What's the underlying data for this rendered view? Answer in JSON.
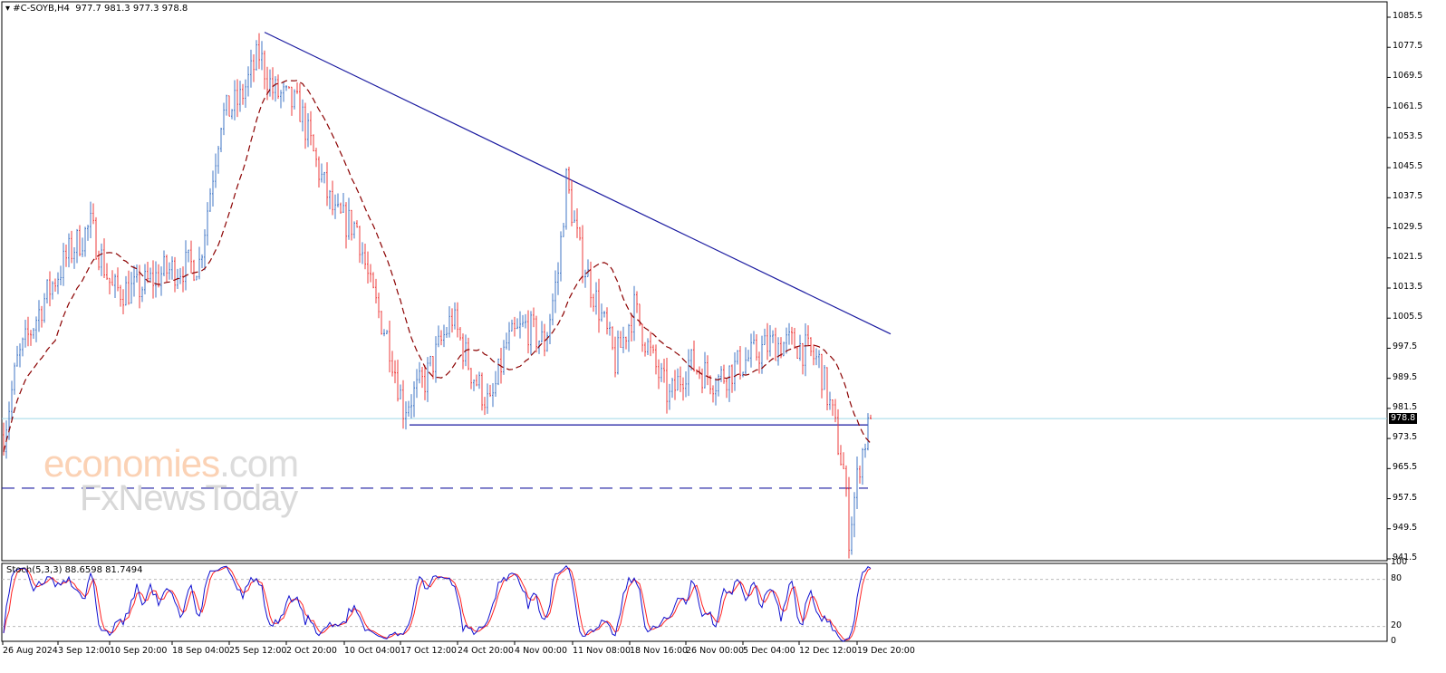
{
  "header": {
    "symbol": "#C-SOYB,H4",
    "ohlc": "977.7 981.3 977.3 978.8"
  },
  "stoch": {
    "label": "Stoch(5,3,3) 88.6598 81.7494",
    "levels": [
      "100",
      "80",
      "20",
      "0"
    ]
  },
  "watermark": {
    "brand1": "economies",
    "brand1_suffix": ".com",
    "brand2": "FxNewsToday"
  },
  "colors": {
    "up": "#3f74c4",
    "down": "#ee3b3b",
    "ma": "#8b0000",
    "trend": "#1a1aa0",
    "price_line": "#9fd8e8",
    "stoch_k": "#1010d0",
    "stoch_d": "#ff2020"
  },
  "chart_data": {
    "type": "ohlc",
    "title": "#C-SOYB,H4",
    "ylim": [
      941.5,
      1085.5
    ],
    "y_ticks": [
      "1085.5",
      "1077.5",
      "1069.5",
      "1061.5",
      "1053.5",
      "1045.5",
      "1037.5",
      "1029.5",
      "1021.5",
      "1013.5",
      "1005.5",
      "997.5",
      "989.5",
      "981.5",
      "973.5",
      "965.5",
      "957.5",
      "949.5",
      "941.5"
    ],
    "current_price": "978.8",
    "x_ticks": [
      "26 Aug 2024",
      "3 Sep 12:00",
      "10 Sep 20:00",
      "18 Sep 04:00",
      "25 Sep 12:00",
      "2 Oct 20:00",
      "10 Oct 04:00",
      "17 Oct 12:00",
      "24 Oct 20:00",
      "4 Nov 00:00",
      "11 Nov 08:00",
      "18 Nov 16:00",
      "26 Nov 00:00",
      "5 Dec 04:00",
      "12 Dec 12:00",
      "19 Dec 20:00"
    ],
    "bar_count": 320,
    "close_path": [
      [
        0,
        974.5
      ],
      [
        5,
        993.8
      ],
      [
        15,
        1010.6
      ],
      [
        24,
        1022.7
      ],
      [
        32,
        1029.9
      ],
      [
        40,
        1013
      ],
      [
        49,
        1013
      ],
      [
        59,
        1017.8
      ],
      [
        72,
        1020.2
      ],
      [
        80,
        1058.8
      ],
      [
        87,
        1063.6
      ],
      [
        94,
        1075.6
      ],
      [
        99,
        1066
      ],
      [
        109,
        1061.2
      ],
      [
        115,
        1046.7
      ],
      [
        122,
        1032.3
      ],
      [
        130,
        1029.9
      ],
      [
        135,
        1013
      ],
      [
        142,
        998.6
      ],
      [
        147,
        981.7
      ],
      [
        155,
        989
      ],
      [
        165,
        1005.8
      ],
      [
        172,
        991.4
      ],
      [
        179,
        981.7
      ],
      [
        185,
        998.6
      ],
      [
        192,
        1003.4
      ],
      [
        199,
        998.6
      ],
      [
        204,
        1017.8
      ],
      [
        207,
        1041.9
      ],
      [
        212,
        1022.7
      ],
      [
        219,
        1008.2
      ],
      [
        225,
        993.8
      ],
      [
        232,
        1008.2
      ],
      [
        239,
        993.8
      ],
      [
        245,
        984.1
      ],
      [
        252,
        993.8
      ],
      [
        262,
        989
      ],
      [
        272,
        993.8
      ],
      [
        282,
        998.6
      ],
      [
        292,
        998.6
      ],
      [
        300,
        993.8
      ],
      [
        305,
        979.3
      ],
      [
        309,
        964.9
      ],
      [
        311,
        948
      ],
      [
        315,
        967.3
      ],
      [
        319,
        978.8
      ]
    ],
    "trendline": {
      "from": [
        "25 Sep",
        1081.5
      ],
      "to": [
        "19 Dec+",
        1001.3
      ]
    },
    "support_level": 977.1,
    "dashed_level": 960.3,
    "ma": {
      "type": "SMA",
      "period": 20,
      "style": "dashed"
    },
    "stochastic": {
      "k": 5,
      "d": 3,
      "slowing": 3,
      "k_value": 88.6598,
      "d_value": 81.7494,
      "levels": [
        20,
        80
      ]
    }
  }
}
